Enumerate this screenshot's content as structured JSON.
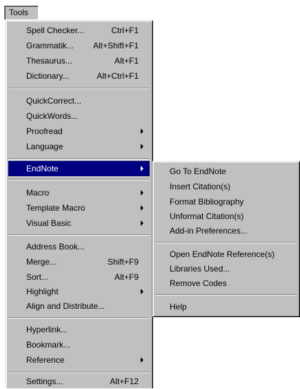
{
  "menubar": {
    "tools_label": "Tools"
  },
  "tools_menu": {
    "items": [
      {
        "label": "Spell Checker...",
        "shortcut": "Ctrl+F1"
      },
      {
        "label": "Grammatik...",
        "shortcut": "Alt+Shift+F1"
      },
      {
        "label": "Thesaurus...",
        "shortcut": "Alt+F1"
      },
      {
        "label": "Dictionary...",
        "shortcut": "Alt+Ctrl+F1"
      },
      {
        "label": "QuickCorrect..."
      },
      {
        "label": "QuickWords..."
      },
      {
        "label": "Proofread",
        "submenu": true
      },
      {
        "label": "Language",
        "submenu": true
      },
      {
        "label": "EndNote",
        "submenu": true,
        "highlighted": true
      },
      {
        "label": "Macro",
        "submenu": true
      },
      {
        "label": "Template Macro",
        "submenu": true
      },
      {
        "label": "Visual Basic",
        "submenu": true
      },
      {
        "label": "Address Book..."
      },
      {
        "label": "Merge...",
        "shortcut": "Shift+F9"
      },
      {
        "label": "Sort...",
        "shortcut": "Alt+F9"
      },
      {
        "label": "Highlight",
        "submenu": true
      },
      {
        "label": "Align and Distribute..."
      },
      {
        "label": "Hyperlink..."
      },
      {
        "label": "Bookmark..."
      },
      {
        "label": "Reference",
        "submenu": true
      },
      {
        "label": "Settings...",
        "shortcut": "Alt+F12"
      }
    ]
  },
  "endnote_menu": {
    "items": [
      {
        "label": "Go To EndNote"
      },
      {
        "label": "Insert Citation(s)"
      },
      {
        "label": "Format Bibliography"
      },
      {
        "label": "Unformat Citation(s)"
      },
      {
        "label": "Add-in Preferences..."
      },
      {
        "label": "Open EndNote Reference(s)"
      },
      {
        "label": "Libraries Used..."
      },
      {
        "label": "Remove Codes"
      },
      {
        "label": "Help"
      }
    ]
  },
  "colors": {
    "menu_bg": "#c0c0c0",
    "highlight_bg": "#000080",
    "highlight_text": "#ffffff"
  }
}
